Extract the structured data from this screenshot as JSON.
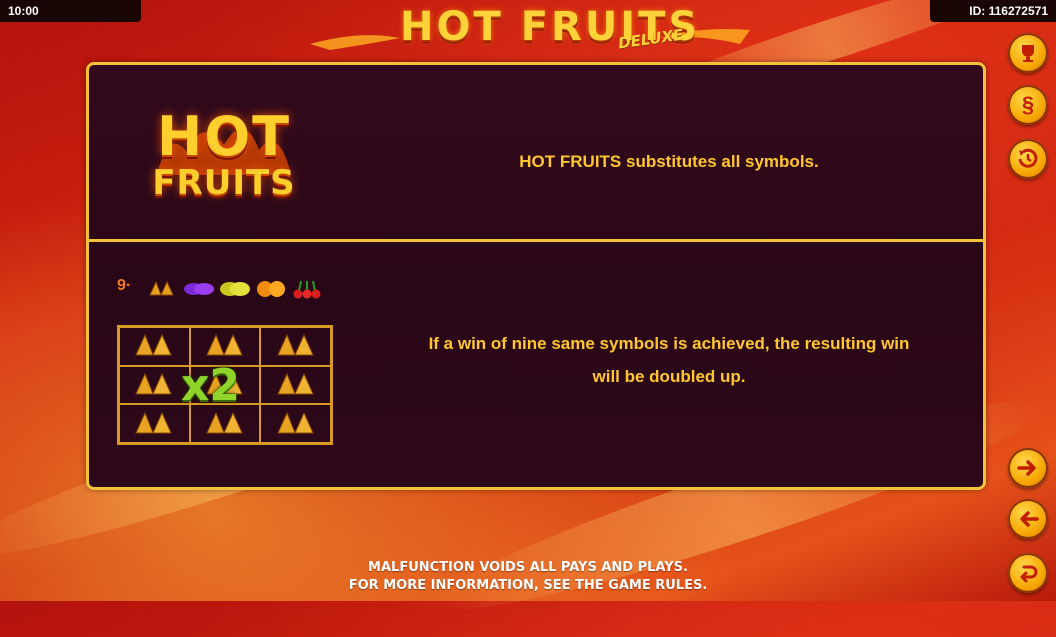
{
  "status_bar": {
    "time": "10:00",
    "id_text": "ID: 116272571"
  },
  "logo": {
    "title": "HOT FRUITS",
    "subtitle": "DELUXE"
  },
  "wild_section": {
    "logo_line1": "HOT",
    "logo_line2": "FRUITS",
    "description": "HOT FRUITS substitutes all symbols."
  },
  "bonus_section": {
    "count_label": "9·",
    "symbols": [
      "bell-icon",
      "plum-icon",
      "lemon-icon",
      "orange-icon",
      "cherry-icon"
    ],
    "multiplier_label": "x2",
    "description_line1": "If a win of nine same symbols is achieved, the resulting win",
    "description_line2": "will be doubled up."
  },
  "side_buttons": [
    "trophy-icon",
    "rules-section-icon",
    "history-icon",
    "next-arrow-icon",
    "prev-arrow-icon",
    "back-icon"
  ],
  "footer": {
    "line1": "MALFUNCTION VOIDS ALL PAYS AND PLAYS.",
    "line2": "FOR MORE INFORMATION, SEE THE GAME RULES."
  },
  "colors": {
    "accent": "#f4c23a",
    "text": "#ffc62e",
    "panel": "#2a0716",
    "background": "#c8200c"
  }
}
